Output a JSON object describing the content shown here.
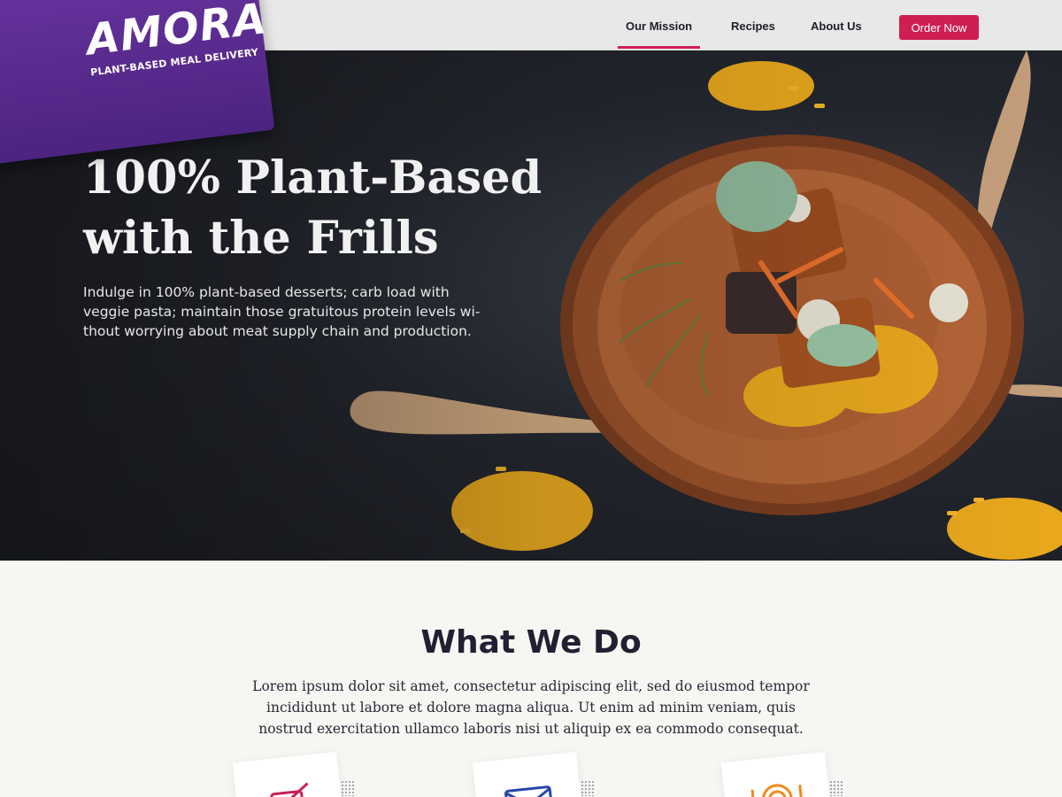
{
  "brand": {
    "name": "AMORA",
    "tagline": "PLANT-BASED MEAL DELIVERY",
    "colors": {
      "purple": "#5a2b91",
      "accent": "#cf1f52",
      "dark": "#231f33"
    }
  },
  "nav": {
    "items": [
      {
        "label": "Our Mission",
        "active": true
      },
      {
        "label": "Recipes",
        "active": false
      },
      {
        "label": "About Us",
        "active": false
      }
    ],
    "cta_label": "Order Now"
  },
  "hero": {
    "title_line1": "100% Plant-Based",
    "title_line2": "with the Frills",
    "subtitle": "Indulge in 100% plant-based desserts; carb load with veggie pasta; maintain those gratuitous protein levels wi-thout worrying about meat supply chain and production."
  },
  "what_we_do": {
    "title": "What We Do",
    "body": "Lorem ipsum dolor sit amet, consectetur adipiscing elit, sed do eiusmod tempor incididunt ut labore et dolore magna aliqua. Ut enim ad minim veniam, quis nostrud exercitation ullamco laboris nisi ut aliquip ex ea commodo consequat.",
    "cards": [
      {
        "icon": "checklist-icon",
        "color": "#c8205a"
      },
      {
        "icon": "envelope-icon",
        "color": "#2446a8"
      },
      {
        "icon": "plate-icon",
        "color": "#f08a1c"
      }
    ]
  }
}
